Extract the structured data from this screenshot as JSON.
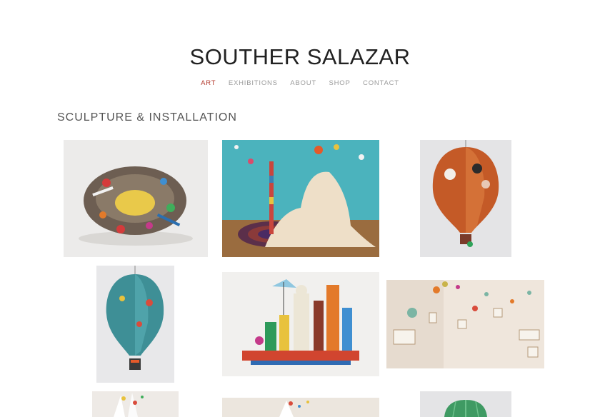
{
  "site": {
    "title": "SOUTHER SALAZAR"
  },
  "nav": {
    "items": [
      {
        "label": "ART",
        "active": true
      },
      {
        "label": "EXHIBITIONS",
        "active": false
      },
      {
        "label": "ABOUT",
        "active": false
      },
      {
        "label": "SHOP",
        "active": false
      },
      {
        "label": "CONTACT",
        "active": false
      }
    ]
  },
  "section": {
    "title": "SCULPTURE & INSTALLATION"
  },
  "gallery": {
    "artworks": [
      {
        "subject": "nest-sculpture"
      },
      {
        "subject": "blue-room-installation"
      },
      {
        "subject": "orange-hot-air-balloon"
      },
      {
        "subject": "teal-hot-air-balloon"
      },
      {
        "subject": "shelf-figures-sculpture"
      },
      {
        "subject": "gallery-wall-balloons"
      },
      {
        "subject": "white-sculpture-partial"
      },
      {
        "subject": "installation-partial"
      },
      {
        "subject": "green-balloon-partial"
      }
    ]
  },
  "colors": {
    "accent": "#b33a2e",
    "nav": "#9a9a9a",
    "title": "#222222"
  }
}
